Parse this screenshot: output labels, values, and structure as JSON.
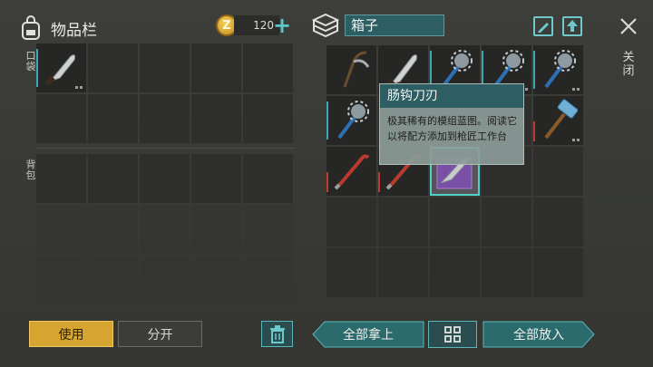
{
  "inventory": {
    "title": "物品栏",
    "coins": "120",
    "coin_symbol": "Z",
    "pocket_label": "口袋",
    "backpack_label": "背包"
  },
  "container": {
    "title": "箱子"
  },
  "close": {
    "label": "关闭"
  },
  "tooltip": {
    "title": "肠钩刀刃",
    "description": "极其稀有的模组蓝图。阅读它以将配方添加到枪匠工作台"
  },
  "bottom_bar": {
    "use_label": "使用",
    "split_label": "分开",
    "take_all_label": "全部拿上",
    "put_all_label": "全部放入"
  },
  "colors": {
    "accent": "#4fd1c6",
    "use_button": "#d6a531",
    "header_fill": "#2c5e63"
  },
  "items": {
    "pocket_slot_1": "machete",
    "box_row1": [
      "sickle",
      "machete",
      "spiked-mace",
      "spiked-mace",
      "spiked-mace"
    ],
    "box_row2": [
      "spiked-mace",
      "",
      "",
      "",
      "sledgehammer"
    ],
    "box_row3": [
      "crowbar",
      "crowbar",
      "blueprint-gut-hook-blade",
      "",
      ""
    ]
  }
}
